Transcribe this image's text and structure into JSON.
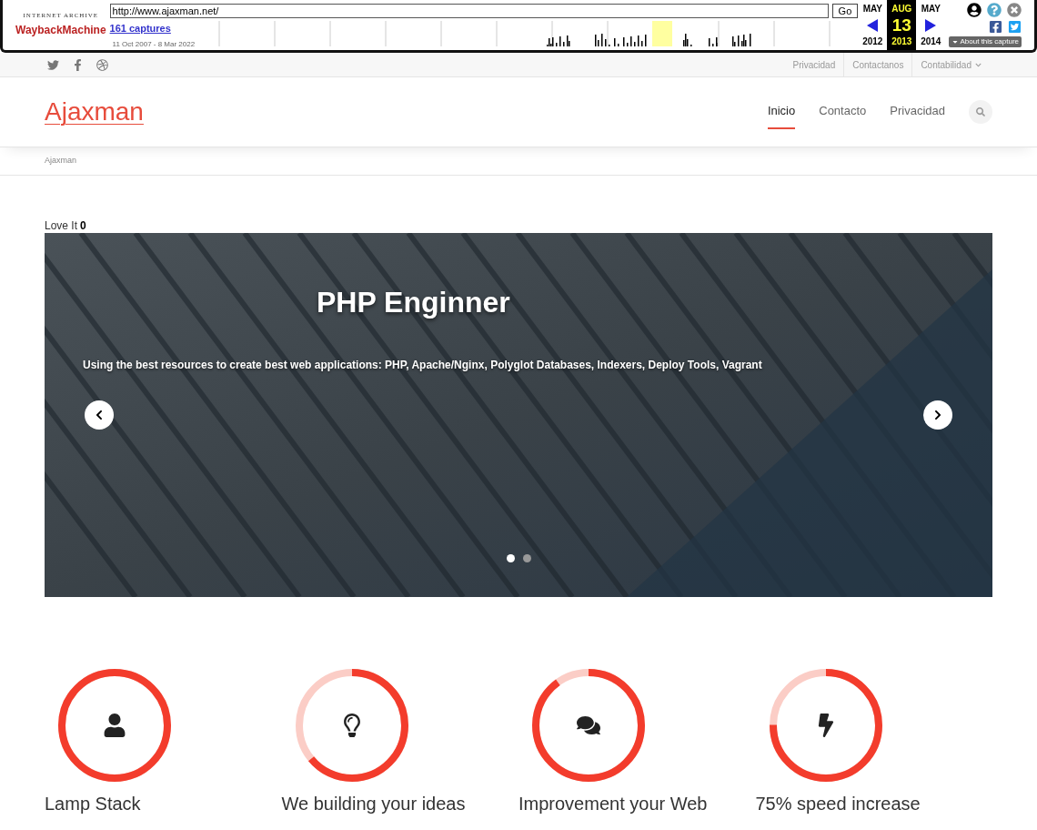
{
  "wayback": {
    "archive_label": "INTERNET ARCHIVE",
    "logo": "WaybackMachine",
    "url": "http://www.ajaxman.net/",
    "go_button": "Go",
    "captures_link": "161 captures",
    "date_range": "11 Oct 2007 - 8 Mar 2022",
    "months": [
      {
        "month": "MAY",
        "year": "2012",
        "selected": false
      },
      {
        "month": "AUG",
        "day": "13",
        "year": "2013",
        "selected": true
      },
      {
        "month": "MAY",
        "year": "2014",
        "selected": false
      }
    ],
    "about_button": "About this capture"
  },
  "top_bar": {
    "links": [
      {
        "label": "Privacidad",
        "caret": false
      },
      {
        "label": "Contactanos",
        "caret": false
      },
      {
        "label": "Contabilidad",
        "caret": true
      }
    ]
  },
  "header": {
    "logo": "Ajaxman",
    "nav": [
      {
        "label": "Inicio",
        "selected": true
      },
      {
        "label": "Contacto",
        "selected": false
      },
      {
        "label": "Privacidad",
        "selected": false
      }
    ]
  },
  "breadcrumb": "Ajaxman",
  "love": {
    "label": "Love It",
    "count": "0"
  },
  "slider": {
    "title": "PHP Enginner",
    "caption": "Using the best resources to create best web applications: PHP, Apache/Nginx, Polyglot Databases, Indexers, Deploy Tools, Vagrant",
    "dots": [
      {
        "selected": true
      },
      {
        "selected": false
      }
    ]
  },
  "features": [
    {
      "kind": "user",
      "level": 1.0,
      "title": "Lamp Stack"
    },
    {
      "kind": "bulb",
      "level": 0.64,
      "title": "We building your ideas"
    },
    {
      "kind": "chat",
      "level": 0.9,
      "title": "Improvement your Web"
    },
    {
      "kind": "bolt",
      "level": 0.75,
      "title": "75% speed increase"
    }
  ]
}
